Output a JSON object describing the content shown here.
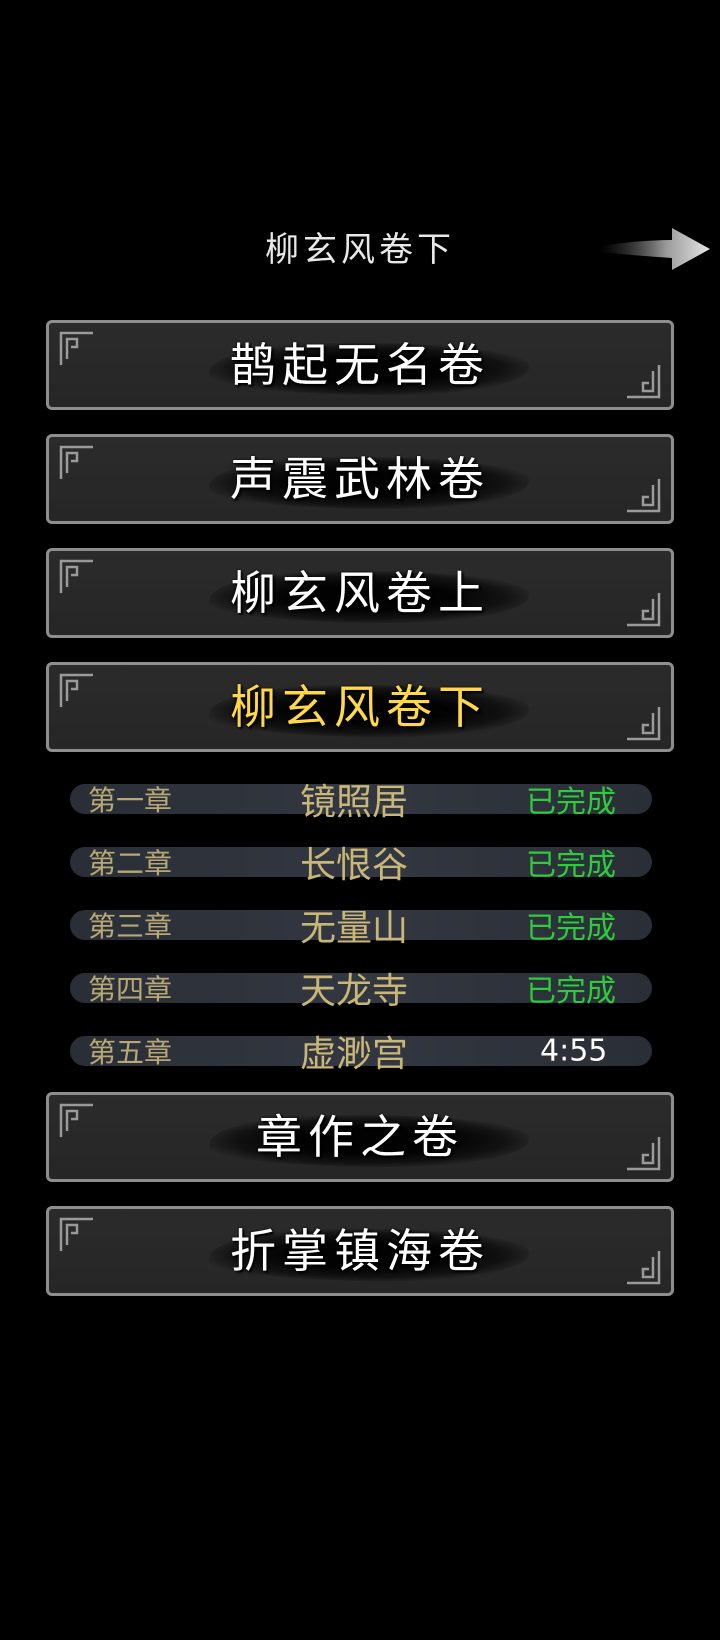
{
  "header": {
    "title": "柳玄风卷下",
    "next_icon": "right-arrow-icon"
  },
  "volumes_top": [
    {
      "title": "鹊起无名卷",
      "active": false
    },
    {
      "title": "声震武林卷",
      "active": false
    },
    {
      "title": "柳玄风卷上",
      "active": false
    },
    {
      "title": "柳玄风卷下",
      "active": true
    }
  ],
  "chapters": [
    {
      "number": "第一章",
      "name": "镜照居",
      "status": "已完成"
    },
    {
      "number": "第二章",
      "name": "长恨谷",
      "status": "已完成"
    },
    {
      "number": "第三章",
      "name": "无量山",
      "status": "已完成"
    },
    {
      "number": "第四章",
      "name": "天龙寺",
      "status": "已完成"
    },
    {
      "number": "第五章",
      "name": "虚渺宫",
      "status": "4:55"
    }
  ],
  "volumes_bottom": [
    {
      "title": "章作之卷",
      "active": false
    },
    {
      "title": "折掌镇海卷",
      "active": false
    }
  ],
  "colors": {
    "active_title": "#ffd84a",
    "completed": "#2ecb3c",
    "chapter_text": "#c9b777"
  }
}
